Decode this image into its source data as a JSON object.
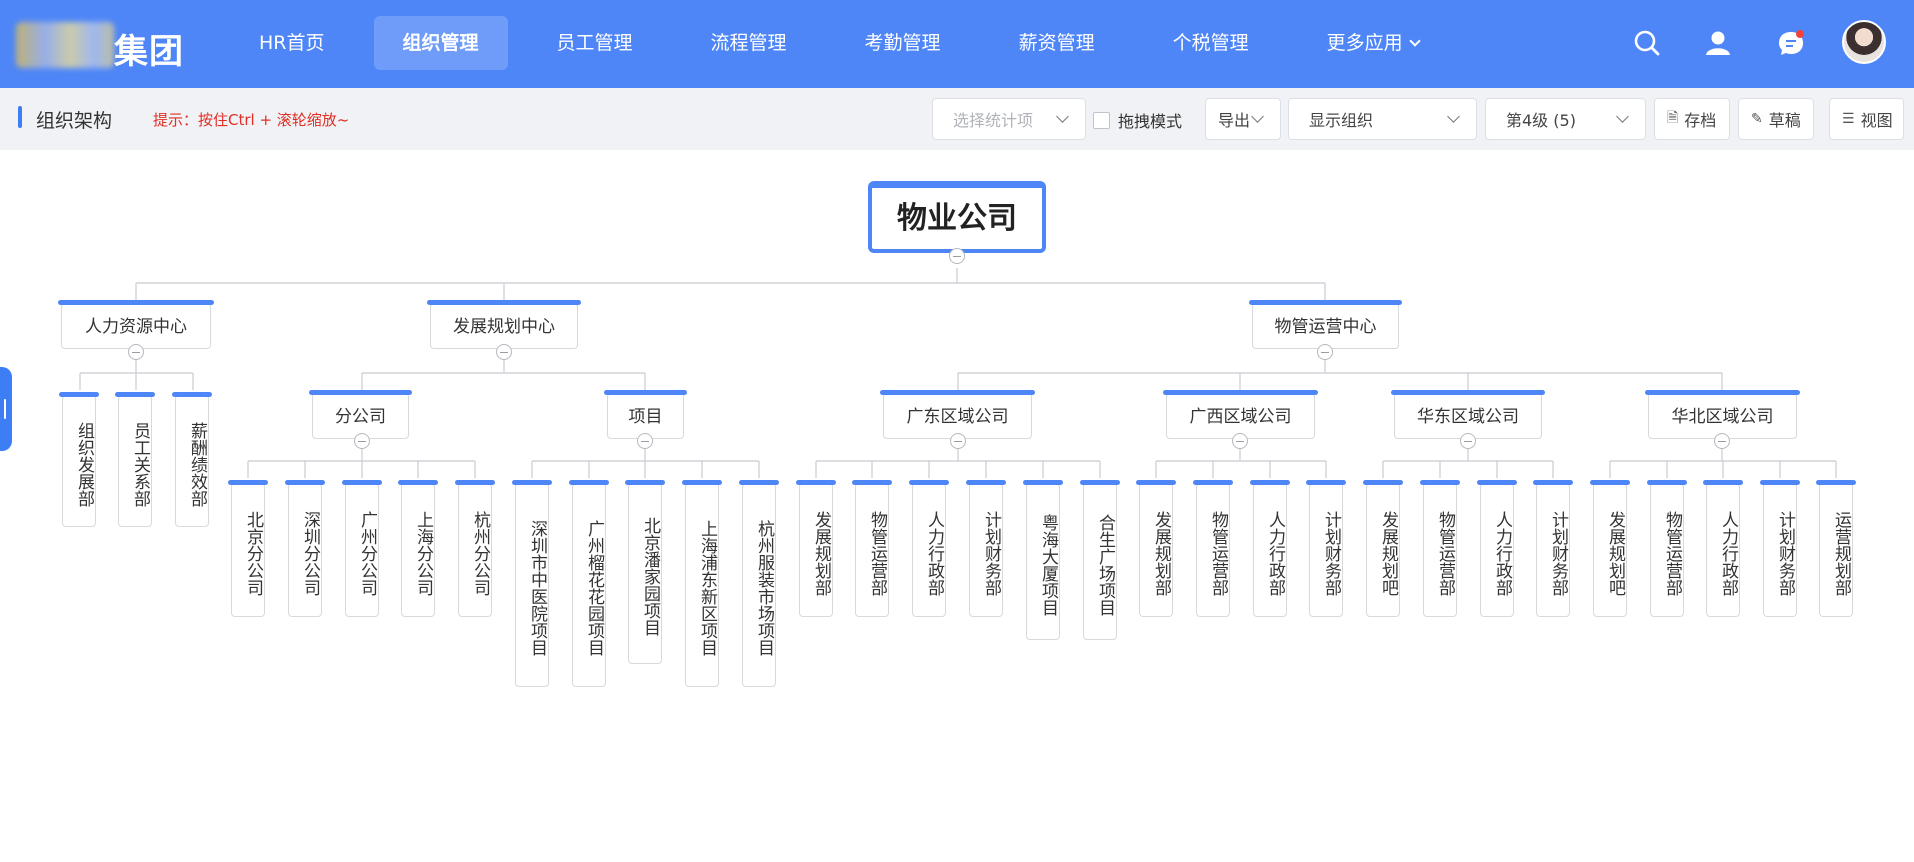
{
  "brand": {
    "text": "集团"
  },
  "nav": {
    "items": [
      {
        "label": "HR首页",
        "active": false
      },
      {
        "label": "组织管理",
        "active": true
      },
      {
        "label": "员工管理",
        "active": false
      },
      {
        "label": "流程管理",
        "active": false
      },
      {
        "label": "考勤管理",
        "active": false
      },
      {
        "label": "薪资管理",
        "active": false
      },
      {
        "label": "个税管理",
        "active": false
      },
      {
        "label": "更多应用",
        "active": false
      }
    ]
  },
  "toolbar": {
    "title": "组织架构",
    "tip": "提示：按住Ctrl + 滚轮缩放~",
    "stat_select_placeholder": "选择统计项",
    "drag_mode_label": "拖拽模式",
    "export_label": "导出",
    "display_select_value": "显示组织",
    "level_select_value": "第4级 (5)",
    "archive_label": "存档",
    "draft_label": "草稿",
    "view_label": "视图"
  },
  "org": {
    "root": "物业公司",
    "l1": [
      "人力资源中心",
      "发展规划中心",
      "物管运营中心"
    ],
    "hr_depts": [
      "组织发展部",
      "员工关系部",
      "薪酬绩效部"
    ],
    "dev_groups": [
      "分公司",
      "项目"
    ],
    "branches": [
      "北京分公司",
      "深圳分公司",
      "广州分公司",
      "上海分公司",
      "杭州分公司"
    ],
    "projects": [
      "深圳市中医院项目",
      "广州榴花花园项目",
      "北京潘家园项目",
      "上海浦东新区项目",
      "杭州服装市场项目"
    ],
    "regions": [
      "广东区域公司",
      "广西区域公司",
      "华东区域公司",
      "华北区域公司"
    ],
    "gd_depts": [
      "发展规划部",
      "物管运营部",
      "人力行政部",
      "计划财务部",
      "粤海大厦项目",
      "合生广场项目"
    ],
    "gx_depts": [
      "发展规划部",
      "物管运营部",
      "人力行政部",
      "计划财务部"
    ],
    "hd_depts": [
      "发展规划吧",
      "物管运营部",
      "人力行政部",
      "计划财务部"
    ],
    "hb_depts": [
      "发展规划吧",
      "物管运营部",
      "人力行政部",
      "计划财务部",
      "运营规划部"
    ]
  },
  "colors": {
    "primary": "#4e86f7",
    "tip": "#e02e24"
  }
}
